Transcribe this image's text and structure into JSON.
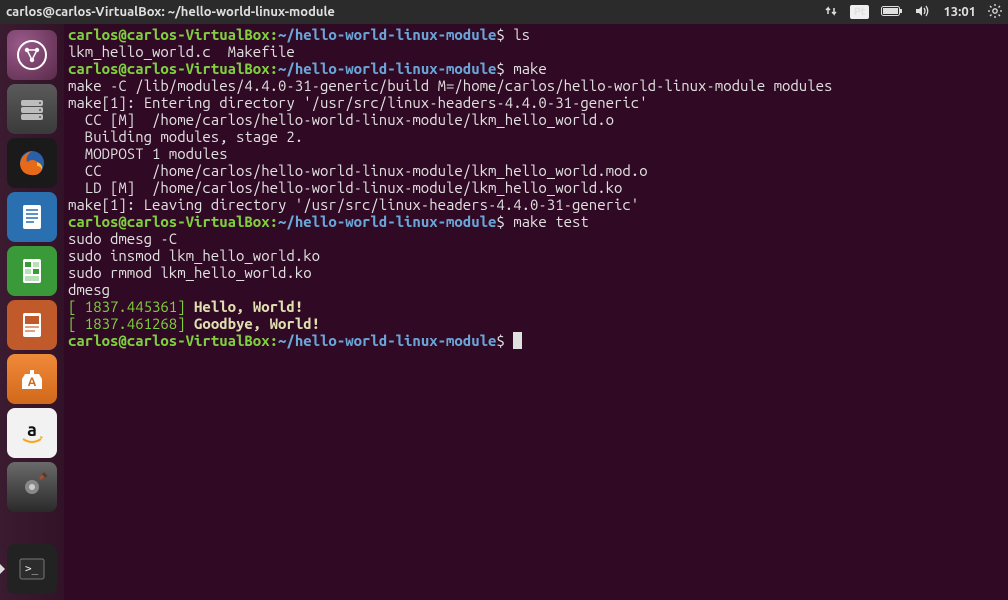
{
  "panel": {
    "title": "carlos@carlos-VirtualBox: ~/hello-world-linux-module",
    "keyboard": "Pt",
    "time": "13:01"
  },
  "prompt": {
    "userhost": "carlos@carlos-VirtualBox",
    "path": "~/hello-world-linux-module",
    "sep": ":",
    "dollar": "$"
  },
  "cmds": {
    "ls": "ls",
    "make": "make",
    "maketest": "make test"
  },
  "out": {
    "ls": "lkm_hello_world.c  Makefile",
    "make1": "make -C /lib/modules/4.4.0-31-generic/build M=/home/carlos/hello-world-linux-module modules",
    "make2": "make[1]: Entering directory '/usr/src/linux-headers-4.4.0-31-generic'",
    "make3": "  CC [M]  /home/carlos/hello-world-linux-module/lkm_hello_world.o",
    "make4": "  Building modules, stage 2.",
    "make5": "  MODPOST 1 modules",
    "make6": "  CC      /home/carlos/hello-world-linux-module/lkm_hello_world.mod.o",
    "make7": "  LD [M]  /home/carlos/hello-world-linux-module/lkm_hello_world.ko",
    "make8": "make[1]: Leaving directory '/usr/src/linux-headers-4.4.0-31-generic'",
    "test1": "sudo dmesg -C",
    "test2": "sudo insmod lkm_hello_world.ko",
    "test3": "sudo rmmod lkm_hello_world.ko",
    "test4": "dmesg",
    "dmesg1_time": "[ 1837.445361] ",
    "dmesg1_msg": "Hello, World!",
    "dmesg2_time": "[ 1837.461268] ",
    "dmesg2_msg": "Goodbye, World!"
  },
  "launcher": {
    "dash": "Dash",
    "files": "Files",
    "firefox": "Firefox",
    "writer": "LibreOffice Writer",
    "calc": "LibreOffice Calc",
    "impress": "LibreOffice Impress",
    "software": "Ubuntu Software",
    "amazon": "Amazon",
    "settings": "System Settings",
    "terminal": "Terminal"
  }
}
